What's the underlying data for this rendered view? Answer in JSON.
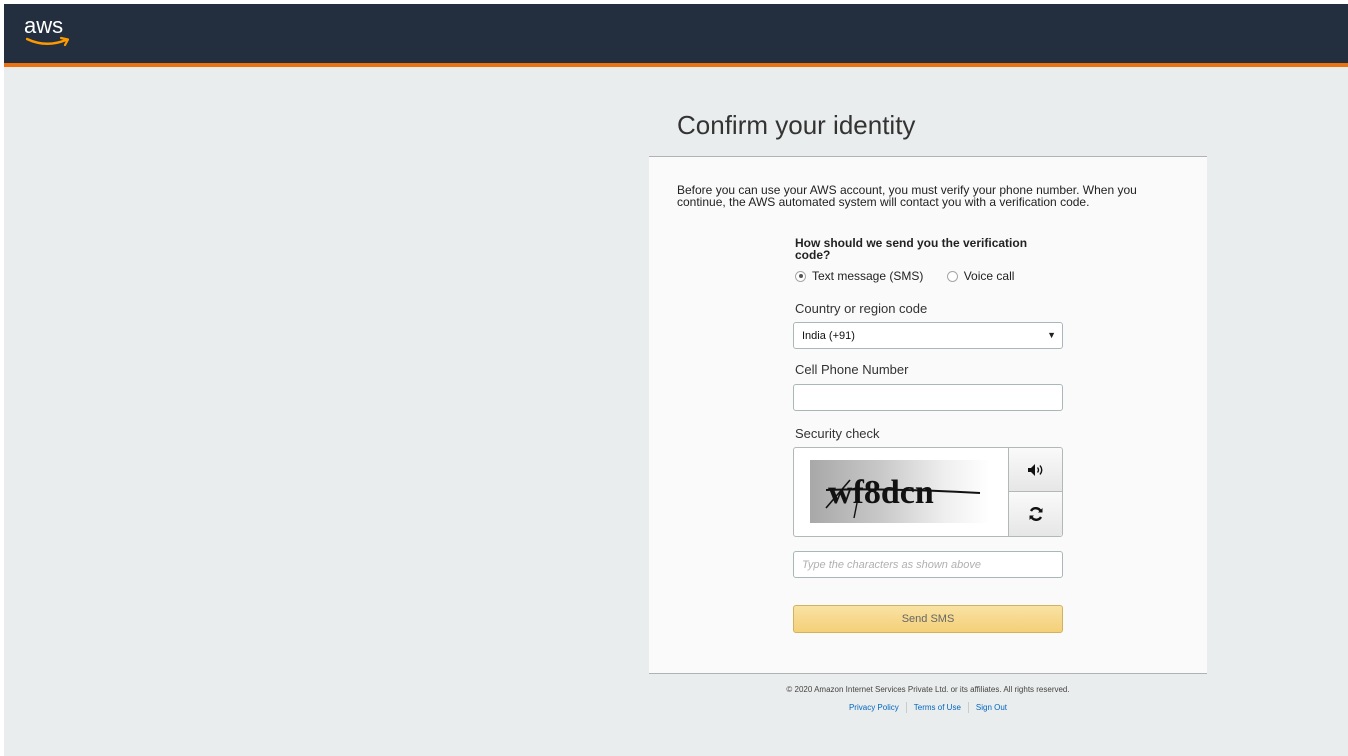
{
  "header": {
    "logo_text": "aws",
    "bg_color": "#232f3e",
    "accent_color": "#ec7211"
  },
  "page": {
    "title": "Confirm your identity",
    "intro": "Before you can use your AWS account, you must verify your phone number. When you continue, the AWS automated system will contact you with a verification code."
  },
  "form": {
    "method_question": "How should we send you the verification code?",
    "methods": [
      {
        "label": "Text message (SMS)",
        "selected": true
      },
      {
        "label": "Voice call",
        "selected": false
      }
    ],
    "country_label": "Country or region code",
    "country_value": "India (+91)",
    "phone_label": "Cell Phone Number",
    "phone_value": "",
    "security_label": "Security check",
    "captcha_text": "wf8dcn",
    "captcha_placeholder": "Type the characters as shown above",
    "submit_label": "Send SMS",
    "submit_color": "#f4d078"
  },
  "footer": {
    "copyright": "© 2020 Amazon Internet Services Private Ltd. or its affiliates. All rights reserved.",
    "links": [
      "Privacy Policy",
      "Terms of Use",
      "Sign Out"
    ]
  }
}
